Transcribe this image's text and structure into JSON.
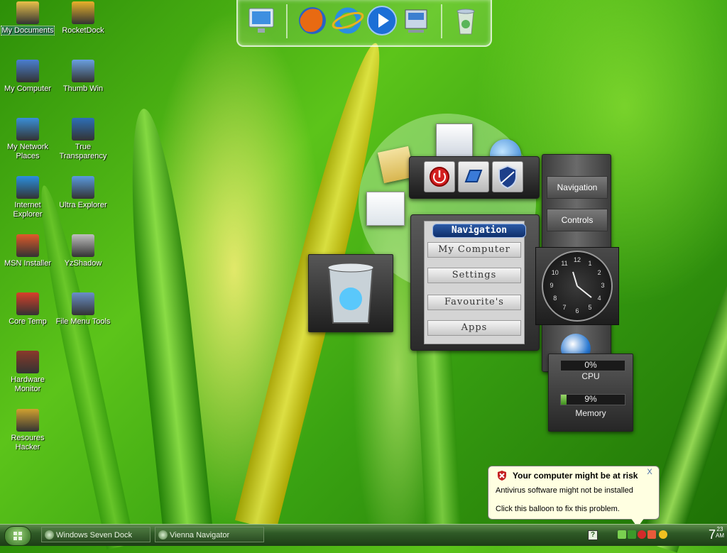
{
  "desktop_icons": [
    {
      "name": "desktop-icon-my-documents",
      "label": "My Documents",
      "color": "#e8c14a"
    },
    {
      "name": "desktop-icon-rocketdock",
      "label": "RocketDock",
      "color": "#e8b12a"
    },
    {
      "name": "desktop-icon-my-computer",
      "label": "My Computer",
      "color": "#4a7fd0"
    },
    {
      "name": "desktop-icon-thumb-win",
      "label": "Thumb Win",
      "color": "#6aa0e0"
    },
    {
      "name": "desktop-icon-my-network-places",
      "label": "My Network Places",
      "color": "#3a8fd8"
    },
    {
      "name": "desktop-icon-true-transparency",
      "label": "True Transparency",
      "color": "#2d6fb8"
    },
    {
      "name": "desktop-icon-internet-explorer",
      "label": "Internet Explorer",
      "color": "#2a8fe0"
    },
    {
      "name": "desktop-icon-ultra-explorer",
      "label": "Ultra Explorer",
      "color": "#5a9ae0"
    },
    {
      "name": "desktop-icon-msn-installer",
      "label": "MSN Installer",
      "color": "#e05a2a"
    },
    {
      "name": "desktop-icon-yzshadow",
      "label": "YzShadow",
      "color": "#bfbfbf"
    },
    {
      "name": "desktop-icon-core-temp",
      "label": "Core Temp",
      "color": "#d8402a"
    },
    {
      "name": "desktop-icon-file-menu-tools",
      "label": "File Menu Tools",
      "color": "#6a8fc8"
    },
    {
      "name": "desktop-icon-hardware-monitor",
      "label": "Hardware Monitor",
      "color": "#8a3a2a"
    },
    {
      "name": "desktop-icon-resources-hacker",
      "label": "Resoures Hacker",
      "color": "#d0a030"
    }
  ],
  "dock": {
    "items": [
      "monitor-icon",
      "firefox-icon",
      "ie-icon",
      "media-player-icon",
      "control-panel-icon",
      "recycle-bin-icon"
    ]
  },
  "navigator": {
    "title": "Navigation",
    "buttons": [
      "My Computer",
      "Settings",
      "Favourite's",
      "Apps"
    ],
    "side_buttons": [
      "Navigation",
      "Controls"
    ]
  },
  "clock_numbers": [
    "12",
    "1",
    "2",
    "3",
    "4",
    "5",
    "6",
    "7",
    "8",
    "9",
    "10",
    "11"
  ],
  "meter": {
    "cpu_value": "0%",
    "cpu_label": "CPU",
    "cpu_fraction": 0.0,
    "memory_value": "9%",
    "memory_label": "Memory",
    "memory_fraction": 0.09
  },
  "balloon": {
    "title": "Your computer might be at risk",
    "line1": "Antivirus software might not be installed",
    "line2": "Click this balloon to fix this problem.",
    "close": "X"
  },
  "taskbar": {
    "tasks": [
      "Windows Seven Dock",
      "Vienna Navigator"
    ],
    "time": "7",
    "time_small": "23",
    "ampm": "AM"
  }
}
